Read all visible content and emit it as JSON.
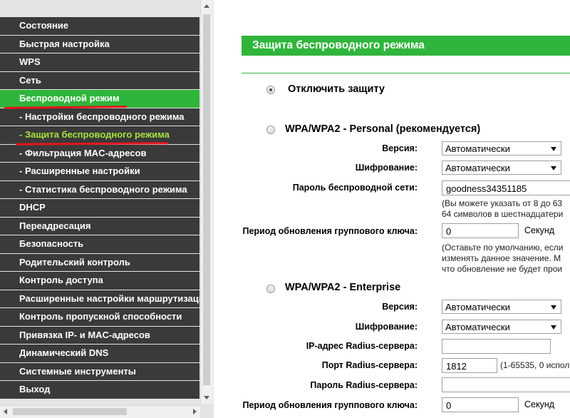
{
  "sidebar": {
    "items": [
      {
        "label": "Состояние"
      },
      {
        "label": "Быстрая настройка"
      },
      {
        "label": "WPS"
      },
      {
        "label": "Сеть"
      },
      {
        "label": "Беспроводной режим"
      },
      {
        "label": "- Настройки беспроводного режима"
      },
      {
        "label": "- Защита беспроводного режима"
      },
      {
        "label": "- Фильтрация MAC-адресов"
      },
      {
        "label": "- Расширенные настройки"
      },
      {
        "label": "- Статистика беспроводного режима"
      },
      {
        "label": "DHCP"
      },
      {
        "label": "Переадресация"
      },
      {
        "label": "Безопасность"
      },
      {
        "label": "Родительский контроль"
      },
      {
        "label": "Контроль доступа"
      },
      {
        "label": "Расширенные настройки маршрутизации"
      },
      {
        "label": "Контроль пропускной способности"
      },
      {
        "label": "Привязка IP- и MAC-адресов"
      },
      {
        "label": "Динамический DNS"
      },
      {
        "label": "Системные инструменты"
      },
      {
        "label": "Выход"
      }
    ],
    "active_item": "Беспроводной режим",
    "current_subitem": "- Защита беспроводного режима"
  },
  "colors": {
    "menu_bg": "#3a3a3a",
    "accent_green": "#2fb53c",
    "current_text": "#a7e43c",
    "annotation_red": "#e8141c"
  },
  "main": {
    "section_title": "Защита беспроводного режима",
    "disable": {
      "label": "Отключить защиту",
      "checked": true
    },
    "personal": {
      "title": "WPA/WPA2 - Personal (рекомендуется)",
      "version_label": "Версия:",
      "version_value": "Автоматически",
      "encryption_label": "Шифрование:",
      "encryption_value": "Автоматически",
      "password_label": "Пароль беспроводной сети:",
      "password_value": "goodness34351185",
      "password_note_1": "(Вы можете указать от 8 до 63",
      "password_note_2": "64 символов в шестнадцатери",
      "group_key_label": "Период обновления группового ключа:",
      "group_key_value": "0",
      "group_key_unit": "Секунд",
      "group_key_note_1": "(Оставьте по умолчанию, если",
      "group_key_note_2": "изменять данное значение. М",
      "group_key_note_3": "что обновление не будет прои"
    },
    "enterprise": {
      "title": "WPA/WPA2 - Enterprise",
      "version_label": "Версия:",
      "version_value": "Автоматически",
      "encryption_label": "Шифрование:",
      "encryption_value": "Автоматически",
      "radius_ip_label": "IP-адрес Radius-сервера:",
      "radius_ip_value": "",
      "radius_port_label": "Порт Radius-сервера:",
      "radius_port_value": "1812",
      "radius_port_note": "(1-65535, 0 испол",
      "radius_password_label": "Пароль Radius-сервера:",
      "radius_password_value": "",
      "group_key_label": "Период обновления группового ключа:",
      "group_key_value": "0",
      "group_key_unit": "Секунд"
    }
  }
}
